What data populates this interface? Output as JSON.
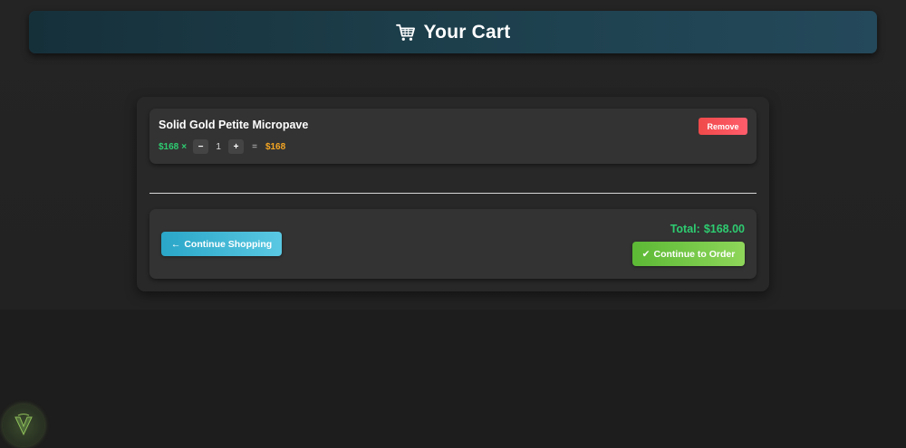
{
  "header": {
    "title": "Your Cart",
    "icon": "cart-icon"
  },
  "cart": {
    "items": [
      {
        "name": "Solid Gold Petite Micropave",
        "unit_price": "$168",
        "times": "×",
        "qty_minus": "−",
        "quantity": "1",
        "qty_plus": "+",
        "equals": "=",
        "line_total": "$168",
        "remove_label": "Remove"
      }
    ]
  },
  "summary": {
    "continue_shopping_label": "Continue Shopping",
    "continue_shopping_icon": "←",
    "total_label": "Total:",
    "total_value": "$168.00",
    "continue_order_label": "Continue to Order",
    "continue_order_icon": "✔"
  },
  "colors": {
    "accent_green": "#2ecc71",
    "price_orange": "#f5a623",
    "remove_red": "#f04a4a",
    "shopping_blue": "#2aa6c8",
    "order_green": "#5cb935"
  }
}
